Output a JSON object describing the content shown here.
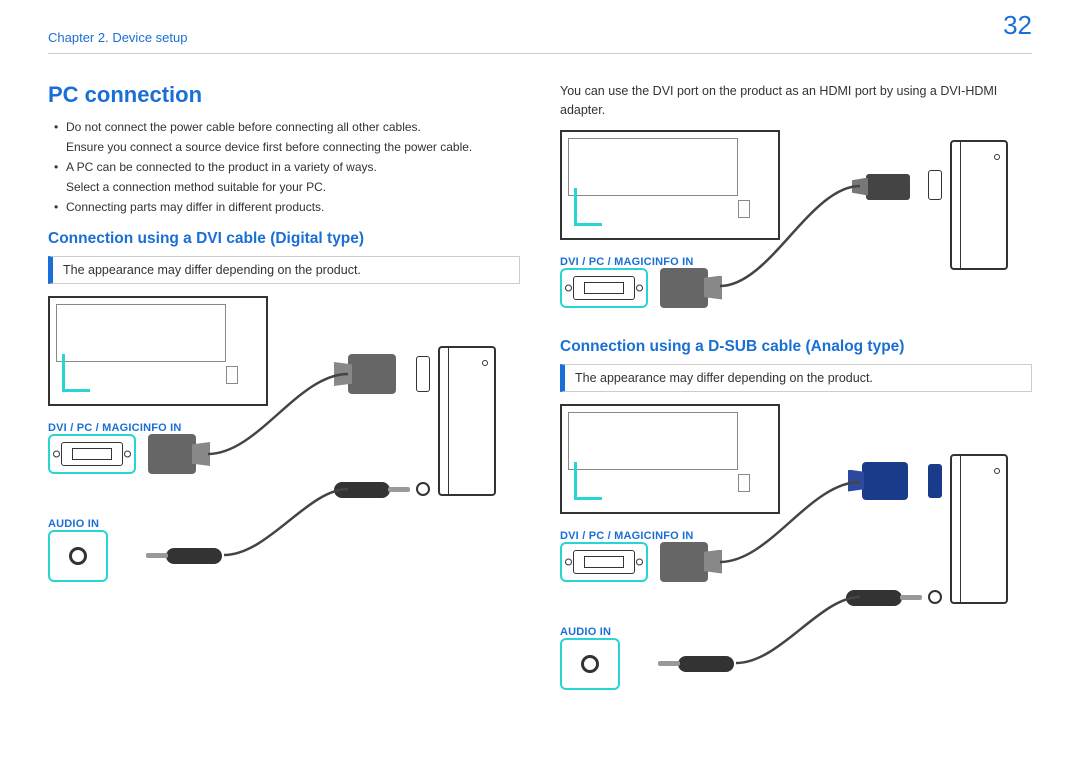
{
  "header": {
    "chapter": "Chapter 2. Device setup",
    "page": "32"
  },
  "left": {
    "title": "PC connection",
    "bullets": [
      "Do not connect the power cable before connecting all other cables.",
      "Ensure you connect a source device first before connecting the power cable.",
      "A PC can be connected to the product in a variety of ways.",
      "Select a connection method suitable for your PC.",
      "Connecting parts may differ in different products."
    ],
    "sub1_title": "Connection using a DVI cable (Digital type)",
    "note": "The appearance may differ depending on the product.",
    "port_dvi": "DVI / PC / MAGICINFO IN",
    "port_audio": "AUDIO IN"
  },
  "right": {
    "intro": "You can use the DVI port on the product as an HDMI port by using a DVI-HDMI adapter.",
    "port_dvi": "DVI / PC / MAGICINFO IN",
    "sub2_title": "Connection using a D-SUB cable (Analog type)",
    "note": "The appearance may differ depending on the product.",
    "port_dvi2": "DVI / PC / MAGICINFO IN",
    "port_audio": "AUDIO IN"
  }
}
